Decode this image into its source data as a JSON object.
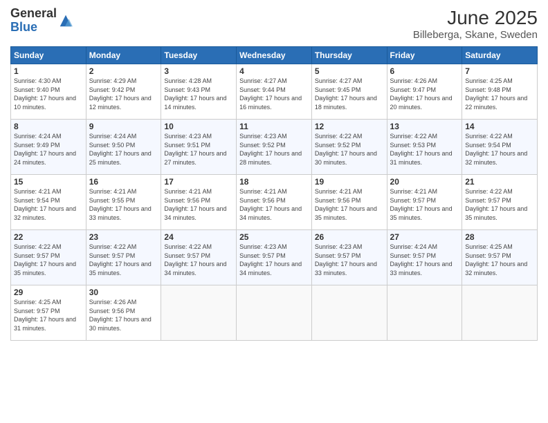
{
  "logo": {
    "general": "General",
    "blue": "Blue"
  },
  "title": "June 2025",
  "subtitle": "Billeberga, Skane, Sweden",
  "headers": [
    "Sunday",
    "Monday",
    "Tuesday",
    "Wednesday",
    "Thursday",
    "Friday",
    "Saturday"
  ],
  "weeks": [
    [
      {
        "day": "1",
        "sunrise": "4:30 AM",
        "sunset": "9:40 PM",
        "daylight": "17 hours and 10 minutes."
      },
      {
        "day": "2",
        "sunrise": "4:29 AM",
        "sunset": "9:42 PM",
        "daylight": "17 hours and 12 minutes."
      },
      {
        "day": "3",
        "sunrise": "4:28 AM",
        "sunset": "9:43 PM",
        "daylight": "17 hours and 14 minutes."
      },
      {
        "day": "4",
        "sunrise": "4:27 AM",
        "sunset": "9:44 PM",
        "daylight": "17 hours and 16 minutes."
      },
      {
        "day": "5",
        "sunrise": "4:27 AM",
        "sunset": "9:45 PM",
        "daylight": "17 hours and 18 minutes."
      },
      {
        "day": "6",
        "sunrise": "4:26 AM",
        "sunset": "9:47 PM",
        "daylight": "17 hours and 20 minutes."
      },
      {
        "day": "7",
        "sunrise": "4:25 AM",
        "sunset": "9:48 PM",
        "daylight": "17 hours and 22 minutes."
      }
    ],
    [
      {
        "day": "8",
        "sunrise": "4:24 AM",
        "sunset": "9:49 PM",
        "daylight": "17 hours and 24 minutes."
      },
      {
        "day": "9",
        "sunrise": "4:24 AM",
        "sunset": "9:50 PM",
        "daylight": "17 hours and 25 minutes."
      },
      {
        "day": "10",
        "sunrise": "4:23 AM",
        "sunset": "9:51 PM",
        "daylight": "17 hours and 27 minutes."
      },
      {
        "day": "11",
        "sunrise": "4:23 AM",
        "sunset": "9:52 PM",
        "daylight": "17 hours and 28 minutes."
      },
      {
        "day": "12",
        "sunrise": "4:22 AM",
        "sunset": "9:52 PM",
        "daylight": "17 hours and 30 minutes."
      },
      {
        "day": "13",
        "sunrise": "4:22 AM",
        "sunset": "9:53 PM",
        "daylight": "17 hours and 31 minutes."
      },
      {
        "day": "14",
        "sunrise": "4:22 AM",
        "sunset": "9:54 PM",
        "daylight": "17 hours and 32 minutes."
      }
    ],
    [
      {
        "day": "15",
        "sunrise": "4:21 AM",
        "sunset": "9:54 PM",
        "daylight": "17 hours and 32 minutes."
      },
      {
        "day": "16",
        "sunrise": "4:21 AM",
        "sunset": "9:55 PM",
        "daylight": "17 hours and 33 minutes."
      },
      {
        "day": "17",
        "sunrise": "4:21 AM",
        "sunset": "9:56 PM",
        "daylight": "17 hours and 34 minutes."
      },
      {
        "day": "18",
        "sunrise": "4:21 AM",
        "sunset": "9:56 PM",
        "daylight": "17 hours and 34 minutes."
      },
      {
        "day": "19",
        "sunrise": "4:21 AM",
        "sunset": "9:56 PM",
        "daylight": "17 hours and 35 minutes."
      },
      {
        "day": "20",
        "sunrise": "4:21 AM",
        "sunset": "9:57 PM",
        "daylight": "17 hours and 35 minutes."
      },
      {
        "day": "21",
        "sunrise": "4:22 AM",
        "sunset": "9:57 PM",
        "daylight": "17 hours and 35 minutes."
      }
    ],
    [
      {
        "day": "22",
        "sunrise": "4:22 AM",
        "sunset": "9:57 PM",
        "daylight": "17 hours and 35 minutes."
      },
      {
        "day": "23",
        "sunrise": "4:22 AM",
        "sunset": "9:57 PM",
        "daylight": "17 hours and 35 minutes."
      },
      {
        "day": "24",
        "sunrise": "4:22 AM",
        "sunset": "9:57 PM",
        "daylight": "17 hours and 34 minutes."
      },
      {
        "day": "25",
        "sunrise": "4:23 AM",
        "sunset": "9:57 PM",
        "daylight": "17 hours and 34 minutes."
      },
      {
        "day": "26",
        "sunrise": "4:23 AM",
        "sunset": "9:57 PM",
        "daylight": "17 hours and 33 minutes."
      },
      {
        "day": "27",
        "sunrise": "4:24 AM",
        "sunset": "9:57 PM",
        "daylight": "17 hours and 33 minutes."
      },
      {
        "day": "28",
        "sunrise": "4:25 AM",
        "sunset": "9:57 PM",
        "daylight": "17 hours and 32 minutes."
      }
    ],
    [
      {
        "day": "29",
        "sunrise": "4:25 AM",
        "sunset": "9:57 PM",
        "daylight": "17 hours and 31 minutes."
      },
      {
        "day": "30",
        "sunrise": "4:26 AM",
        "sunset": "9:56 PM",
        "daylight": "17 hours and 30 minutes."
      },
      null,
      null,
      null,
      null,
      null
    ]
  ],
  "labels": {
    "sunrise": "Sunrise:",
    "sunset": "Sunset:",
    "daylight": "Daylight:"
  },
  "colors": {
    "header_bg": "#2a6eb5",
    "accent": "#2a6eb5"
  }
}
